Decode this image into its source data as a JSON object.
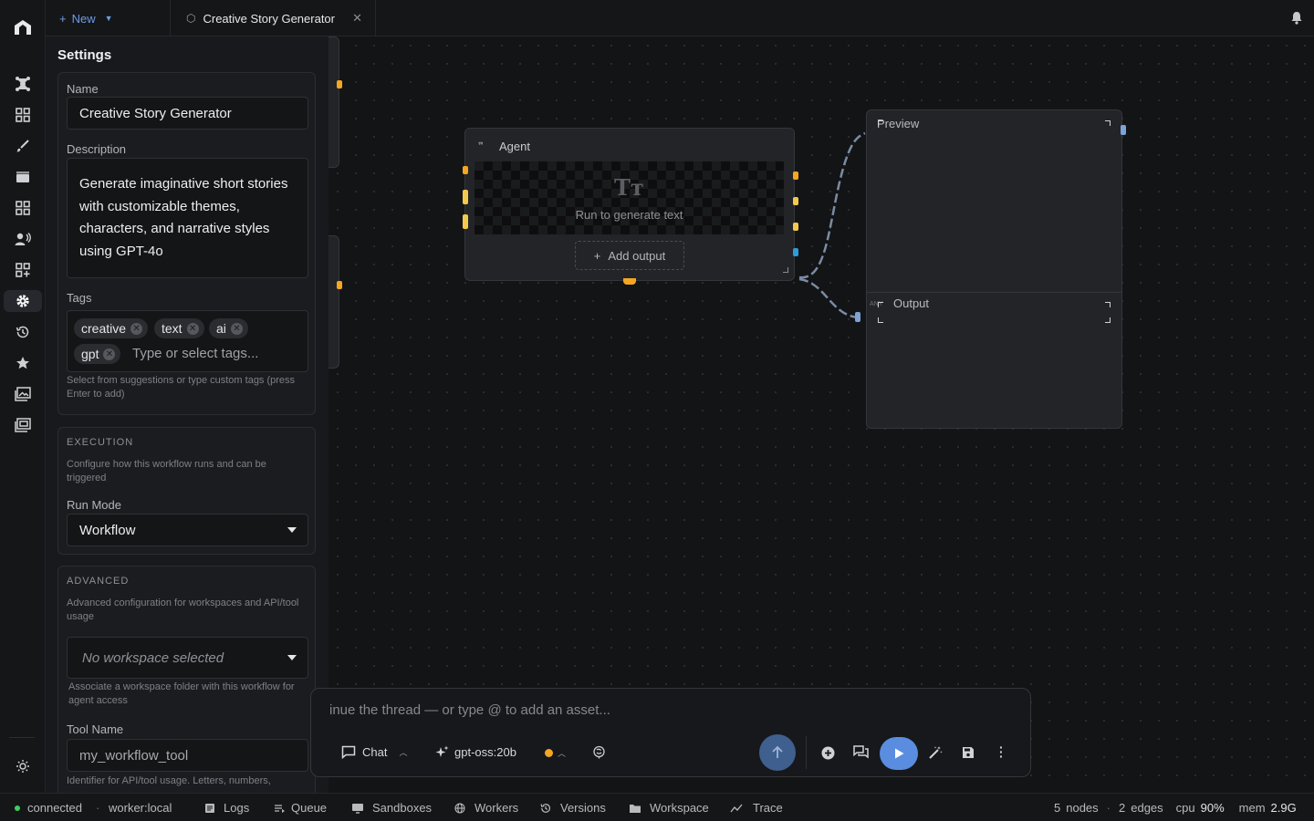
{
  "app": {
    "logo": "logo-icon"
  },
  "rail": {
    "items": [
      {
        "name": "nodes-icon"
      },
      {
        "name": "dashboard-icon"
      },
      {
        "name": "brush-icon"
      },
      {
        "name": "film-icon"
      },
      {
        "name": "grid-icon"
      },
      {
        "name": "voice-icon"
      },
      {
        "name": "apps-icon"
      },
      {
        "name": "settings-icon",
        "active": true
      },
      {
        "name": "history-icon"
      },
      {
        "name": "star-icon"
      },
      {
        "name": "gallery-icon"
      },
      {
        "name": "library-icon"
      }
    ],
    "theme": "theme-toggle-icon"
  },
  "tabs": {
    "new_label": "New",
    "doc_label": "Creative Story Generator"
  },
  "settings": {
    "title": "Settings",
    "name_label": "Name",
    "name_value": "Creative Story Generator",
    "description_label": "Description",
    "description_value": "Generate imaginative short stories with customizable themes, characters, and narrative styles using GPT-4o",
    "tags_label": "Tags",
    "tags": [
      "creative",
      "text",
      "ai",
      "gpt"
    ],
    "tags_placeholder": "Type or select tags...",
    "tags_hint": "Select from suggestions or type custom tags (press Enter to add)",
    "execution_title": "EXECUTION",
    "execution_desc": "Configure how this workflow runs and can be triggered",
    "run_mode_label": "Run Mode",
    "run_mode_value": "Workflow",
    "advanced_title": "ADVANCED",
    "advanced_desc": "Advanced configuration for workspaces and API/tool usage",
    "workspace_value": "No workspace selected",
    "workspace_hint": "Associate a workspace folder with this workflow for agent access",
    "tool_name_label": "Tool Name",
    "tool_name_value": "my_workflow_tool",
    "tool_name_hint": "Identifier for API/tool usage. Letters, numbers,"
  },
  "nodes": {
    "agent": {
      "title": "Agent",
      "placeholder": "Run to generate text",
      "add_output": "Add output"
    },
    "preview": {
      "title": "Preview"
    },
    "output": {
      "title": "Output",
      "tag": "ANY"
    }
  },
  "chat": {
    "placeholder": "inue the thread — or type @ to add an asset...",
    "mode": "Chat",
    "model": "gpt-oss:20b"
  },
  "status": {
    "connection": "connected",
    "worker": "worker:local",
    "links": [
      "Logs",
      "Queue",
      "Sandboxes",
      "Workers",
      "Versions",
      "Workspace",
      "Trace"
    ],
    "nodes_count": "5",
    "nodes_label": "nodes",
    "edges_count": "2",
    "edges_label": "edges",
    "cpu_label": "cpu",
    "cpu_value": "90%",
    "mem_label": "mem",
    "mem_value": "2.9G"
  },
  "colors": {
    "accent": "#6c9de6",
    "run": "#5a8de0",
    "port_orange": "#f5a623",
    "port_yellow": "#f2c94c",
    "port_blue": "#2d9cdb",
    "connected": "#3ecf5e"
  }
}
